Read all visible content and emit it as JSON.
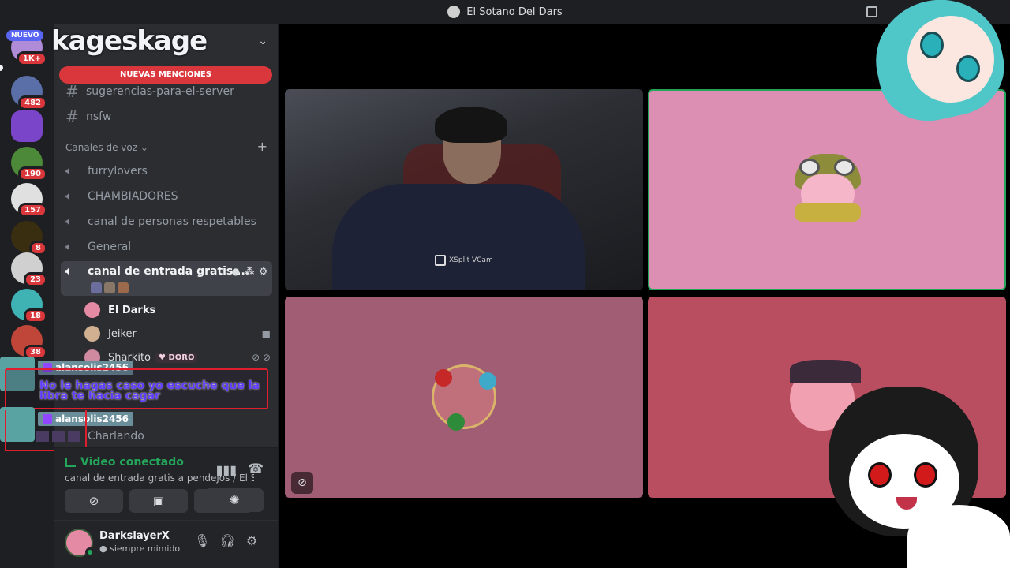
{
  "window": {
    "title": "El Sotano Del Dars"
  },
  "rail": {
    "nuevo_label": "NUEVO",
    "guilds": [
      {
        "badge": "1K+",
        "color": "#b08cd8"
      },
      {
        "badge": "482",
        "color": "#5a6fa8"
      },
      {
        "badge": "",
        "color": "#7b45c9"
      },
      {
        "badge": "190",
        "color": "#4c8a3a"
      },
      {
        "badge": "157",
        "color": "#e0e0e0"
      },
      {
        "badge": "8",
        "color": "#3a2e10"
      },
      {
        "badge": "23",
        "color": "#d0d0d0"
      },
      {
        "badge": "18",
        "color": "#3fb3b3"
      },
      {
        "badge": "38",
        "color": "#c0463a"
      }
    ]
  },
  "sidebar": {
    "server_name": "kageskage",
    "mentions_banner": "NUEVAS MENCIONES",
    "text_channels": [
      "sugerencias-para-el-server",
      "nsfw"
    ],
    "voice_category": "Canales de voz",
    "voice_channels": [
      "furrylovers",
      "CHAMBIADORES",
      "canal de personas respetables",
      "General"
    ],
    "active_channel": "canal de entrada gratis ...",
    "members": [
      {
        "name": "El Darks",
        "color": "#e58aa5"
      },
      {
        "name": "Jeiker",
        "color": "#d0b090"
      },
      {
        "name": "Sharkito",
        "color": "#d08aa0",
        "tag": "DORO"
      }
    ],
    "partial_channel": "Charlando"
  },
  "chat_overlay": {
    "user1": "alansolis2456",
    "message": "No le hagas caso yo escuche que la libra te hacia cagar",
    "user2": "alansolis2456"
  },
  "voice_panel": {
    "status": "Video conectado",
    "channel": "canal de entrada gratis a pendejos / El So..."
  },
  "user_panel": {
    "username": "DarkslayerX",
    "status": "siempre mimido"
  },
  "stage": {
    "camera_label": "XSplit VCam"
  },
  "colors": {
    "accent_red": "#da373c",
    "online_green": "#23a55a",
    "blurple": "#5865f2"
  }
}
